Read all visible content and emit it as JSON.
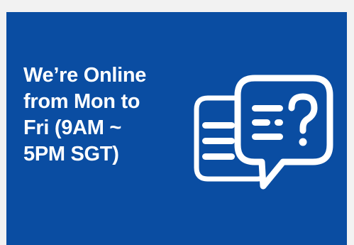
{
  "banner": {
    "line1": "We’re Online",
    "line2": "from Mon to",
    "line3": "Fri (9AM ~",
    "line4": "5PM SGT)",
    "background_color": "#0a4da2",
    "text_color": "#ffffff",
    "graphic_icon": "chat-bubbles-question-icon"
  }
}
